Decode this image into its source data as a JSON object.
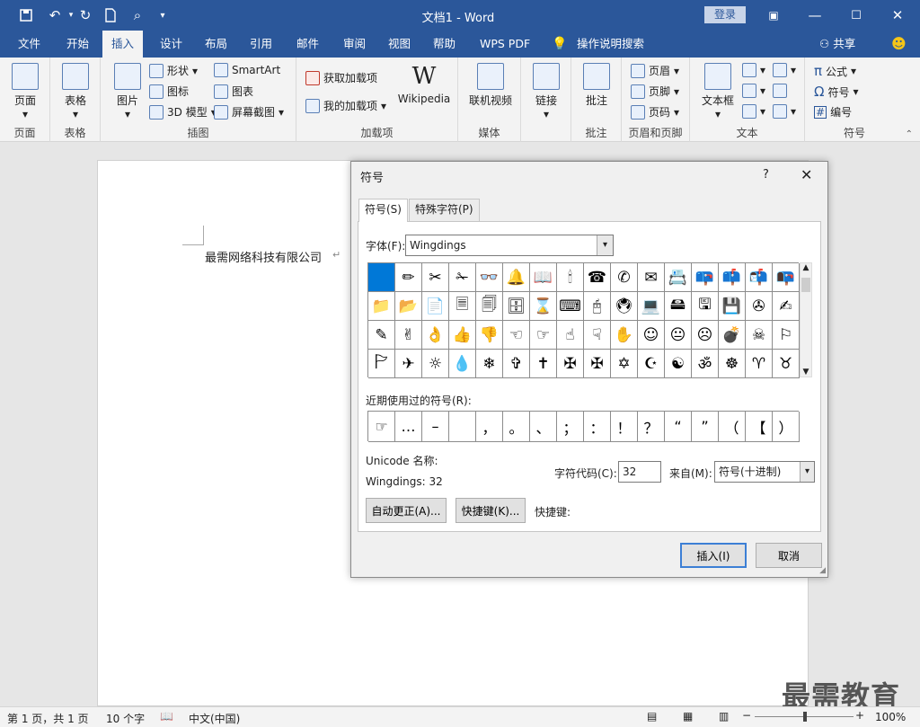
{
  "titlebar": {
    "doc_title": "文档1  -  Word",
    "login": "登录"
  },
  "menu": [
    "文件",
    "开始",
    "插入",
    "设计",
    "布局",
    "引用",
    "邮件",
    "审阅",
    "视图",
    "帮助",
    "WPS PDF",
    "操作说明搜索"
  ],
  "share": "共享",
  "ribbon": {
    "groups": {
      "pages": "页面",
      "tables": "表格",
      "illustrations": "插图",
      "addins": "加载项",
      "media": "媒体",
      "comments": "批注",
      "header_footer": "页眉和页脚",
      "text": "文本",
      "symbols": "符号"
    },
    "buttons": {
      "page": "页面",
      "table": "表格",
      "picture": "图片",
      "shapes": "形状",
      "icons": "图标",
      "model3d": "3D 模型",
      "smartart": "SmartArt",
      "chart": "图表",
      "screenshot": "屏幕截图",
      "get_addins": "获取加载项",
      "my_addins": "我的加载项",
      "wikipedia": "Wikipedia",
      "online_video": "联机视频",
      "link": "链接",
      "comment": "批注",
      "header": "页眉",
      "footer": "页脚",
      "page_number": "页码",
      "textbox": "文本框",
      "equation": "公式",
      "symbol": "符号",
      "number": "编号"
    }
  },
  "document": {
    "text": "最需网络科技有限公司"
  },
  "dialog": {
    "title": "符号",
    "help": "?",
    "tabs": [
      "符号(S)",
      "特殊字符(P)"
    ],
    "font_label": "字体(F):",
    "font_value": "Wingdings",
    "symbols": [
      "",
      "✏",
      "✂",
      "✁",
      "👓",
      "🔔",
      "📖",
      "🕯",
      "☎",
      "✆",
      "✉",
      "📇",
      "📪",
      "📫",
      "📬",
      "📭",
      "📁",
      "📂",
      "📄",
      "🗏",
      "🗐",
      "🗄",
      "⌛",
      "⌨",
      "🖰",
      "🖲",
      "💻",
      "🖴",
      "🖫",
      "💾",
      "✇",
      "✍",
      "✎",
      "✌",
      "👌",
      "👍",
      "👎",
      "☜",
      "☞",
      "☝",
      "☟",
      "✋",
      "☺",
      "😐",
      "☹",
      "💣",
      "☠",
      "⚐",
      "🏱",
      "✈",
      "☼",
      "💧",
      "❄",
      "✞",
      "✝",
      "✠",
      "✠",
      "✡",
      "☪",
      "☯",
      "ॐ",
      "☸",
      "♈",
      "♉"
    ],
    "recent_label": "近期使用过的符号(R):",
    "recent": [
      "☞",
      "…",
      "–",
      " ",
      "，",
      "。",
      "、",
      "；",
      "：",
      "！",
      "？",
      "“",
      "”",
      "（",
      "【",
      "）"
    ],
    "unicode_name_label": "Unicode 名称:",
    "unicode_name_value": "Wingdings: 32",
    "char_code_label": "字符代码(C):",
    "char_code_value": "32",
    "from_label": "来自(M):",
    "from_value": "符号(十进制)",
    "autocorrect": "自动更正(A)...",
    "shortcut_key_btn": "快捷键(K)...",
    "shortcut_key_label": "快捷键:",
    "insert": "插入(I)",
    "cancel": "取消"
  },
  "status": {
    "page": "第 1 页，共 1 页",
    "words": "10 个字",
    "lang": "中文(中国)",
    "zoom": "100%"
  },
  "watermark": "最需教育"
}
